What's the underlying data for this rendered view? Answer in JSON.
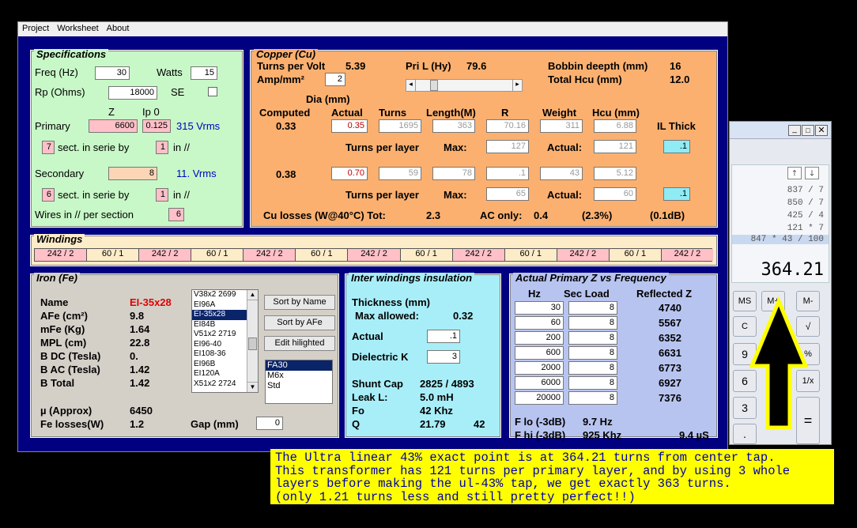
{
  "menu": [
    "Project",
    "Worksheet",
    "About"
  ],
  "spec": {
    "title": "Specifications",
    "freq_label": "Freq (Hz)",
    "freq": "30",
    "watts_label": "Watts",
    "watts": "15",
    "rp_label": "Rp (Ohms)",
    "rp": "18000",
    "se_label": "SE",
    "z_label": "Z",
    "ip0_label": "Ip 0",
    "primary_label": "Primary",
    "primary_z": "6600",
    "primary_ip0": "0.125",
    "primary_vrms": "315 Vrms",
    "p_sect": "7",
    "sect_label": "sect. in serie by",
    "p_par": "1",
    "in_label": "in //",
    "secondary_label": "Secondary",
    "secondary_z": "8",
    "secondary_vrms": "11. Vrms",
    "s_sect": "6",
    "s_par": "1",
    "wires_label": "Wires in // per section",
    "wires": "6"
  },
  "copper": {
    "title": "Copper (Cu)",
    "tpv_label": "Turns per Volt",
    "tpv": "5.39",
    "amp_label": "Amp/mm²",
    "amp": "2",
    "pril_label": "Pri L (Hy)",
    "pril": "79.6",
    "bobbin_label": "Bobbin deepth (mm)",
    "bobbin": "16",
    "hcu_label": "Total Hcu (mm)",
    "hcu": "12.0",
    "dia_label": "Dia (mm)",
    "computed_label": "Computed",
    "actual_label": "Actual",
    "turns_label": "Turns",
    "length_label": "Length(M)",
    "r_label": "R",
    "weight_label": "Weight",
    "hcumm_label": "Hcu (mm)",
    "il_label": "IL Thick",
    "row1": {
      "computed": "0.33",
      "actual": "0.35",
      "turns": "1695",
      "length": "363",
      "r": "70.16",
      "weight": "311",
      "hcu": "6.88",
      "il": ".1"
    },
    "tpl_label": "Turns per layer",
    "max_label": "Max:",
    "actual2_label": "Actual:",
    "tpl1_max": "127",
    "tpl1_actual": "121",
    "row2": {
      "computed": "0.38",
      "actual": "0.70",
      "turns": "59",
      "length": "78",
      "r": ".1",
      "weight": "43",
      "hcu": "5.12",
      "il": ".1"
    },
    "tpl2_max": "65",
    "tpl2_actual": "60",
    "losses_label": "Cu losses (W@40°C) Tot:",
    "losses_tot": "2.3",
    "ac_label": "AC only:",
    "ac": "0.4",
    "pct": "(2.3%)",
    "db": "(0.1dB)"
  },
  "windings": {
    "title": "Windings",
    "cells": [
      "242 / 2",
      "60 / 1",
      "242 / 2",
      "60 / 1",
      "242 / 2",
      "60 / 1",
      "242 / 2",
      "60 / 1",
      "242 / 2",
      "60 / 1",
      "242 / 2",
      "60 / 1",
      "242 / 2"
    ]
  },
  "iron": {
    "title": "Iron (Fe)",
    "rows": [
      {
        "k": "Name",
        "v": "EI-35x28"
      },
      {
        "k": "AFe (cm²)",
        "v": "9.8"
      },
      {
        "k": "mFe (Kg)",
        "v": "1.64"
      },
      {
        "k": "MPL (cm)",
        "v": "22.8"
      },
      {
        "k": "B DC (Tesla)",
        "v": "0."
      },
      {
        "k": "B AC (Tesla)",
        "v": "1.42"
      },
      {
        "k": "B Total",
        "v": "1.42"
      }
    ],
    "mu_label": "µ (Approx)",
    "mu": "6450",
    "fel_label": "Fe losses(W)",
    "fel": "1.2",
    "gap_label": "Gap (mm)",
    "gap": "0",
    "list": [
      "V38x2  2699",
      "EI96A",
      "EI-35x28",
      "EI84B",
      "V51x2  2719",
      "EI96-40",
      "EI108-36",
      "EI96B",
      "EI120A",
      "X51x2  2724"
    ],
    "sort_name": "Sort by Name",
    "sort_afe": "Sort by AFe",
    "edit": "Edit hilighted",
    "materials": [
      "FA30",
      "M6x",
      "Std"
    ]
  },
  "inter": {
    "title": "Inter windings insulation",
    "thick_label": "Thickness (mm)",
    "max_label": "Max allowed:",
    "max": "0.32",
    "actual_label": "Actual",
    "actual": ".1",
    "dk_label": "Dielectric K",
    "dk": "3",
    "shunt_label": "Shunt Cap",
    "shunt": "2825 / 4893",
    "leak_label": "Leak L:",
    "leak": "5.0 mH",
    "fo_label": "Fo",
    "fo": "42 Khz",
    "q_label": "Q",
    "q": "21.79",
    "q2": "42"
  },
  "zf": {
    "title": "Actual Primary Z vs Frequency",
    "hz_label": "Hz",
    "sec_label": "Sec Load",
    "refl_label": "Reflected Z",
    "rows": [
      {
        "hz": "30",
        "load": "8",
        "z": "4740"
      },
      {
        "hz": "60",
        "load": "8",
        "z": "5567"
      },
      {
        "hz": "200",
        "load": "8",
        "z": "6352"
      },
      {
        "hz": "600",
        "load": "8",
        "z": "6631"
      },
      {
        "hz": "2000",
        "load": "8",
        "z": "6773"
      },
      {
        "hz": "6000",
        "load": "8",
        "z": "6927"
      },
      {
        "hz": "20000",
        "load": "8",
        "z": "7376"
      }
    ],
    "flo_label": "F lo (-3dB)",
    "flo": "9.7 Hz",
    "fhi_label": "F hi (-3dB)",
    "fhi": "925 Khz",
    "rise": "9.4 µS"
  },
  "calc": {
    "history": [
      "837 / 7",
      "850 / 7",
      "425 / 4",
      "121 * 7",
      "847 * 43 / 100"
    ],
    "display": "364.21",
    "keys": [
      "MS",
      "M+",
      "M-",
      "C",
      "±",
      "√",
      "9",
      "8",
      "%",
      "6",
      "5",
      "1/x",
      "3",
      "2",
      "=",
      ".",
      "+"
    ]
  },
  "note": [
    "The Ultra linear 43% exact point is at 364.21 turns from center tap.",
    "This transformer has 121 turns per primary layer, and by using 3 whole",
    "layers before making the ul-43% tap, we get exactly 363 turns.",
    "(only 1.21 turns less and still pretty perfect!!)"
  ],
  "colors": {
    "window": "#000080",
    "spec": "#c8f8c8",
    "copper": "#fbb070",
    "windings": "#fdecc8",
    "iron": "#d4d0c8",
    "inter": "#a8eef8",
    "zf": "#b8c4f0",
    "note": "#ffff00"
  }
}
